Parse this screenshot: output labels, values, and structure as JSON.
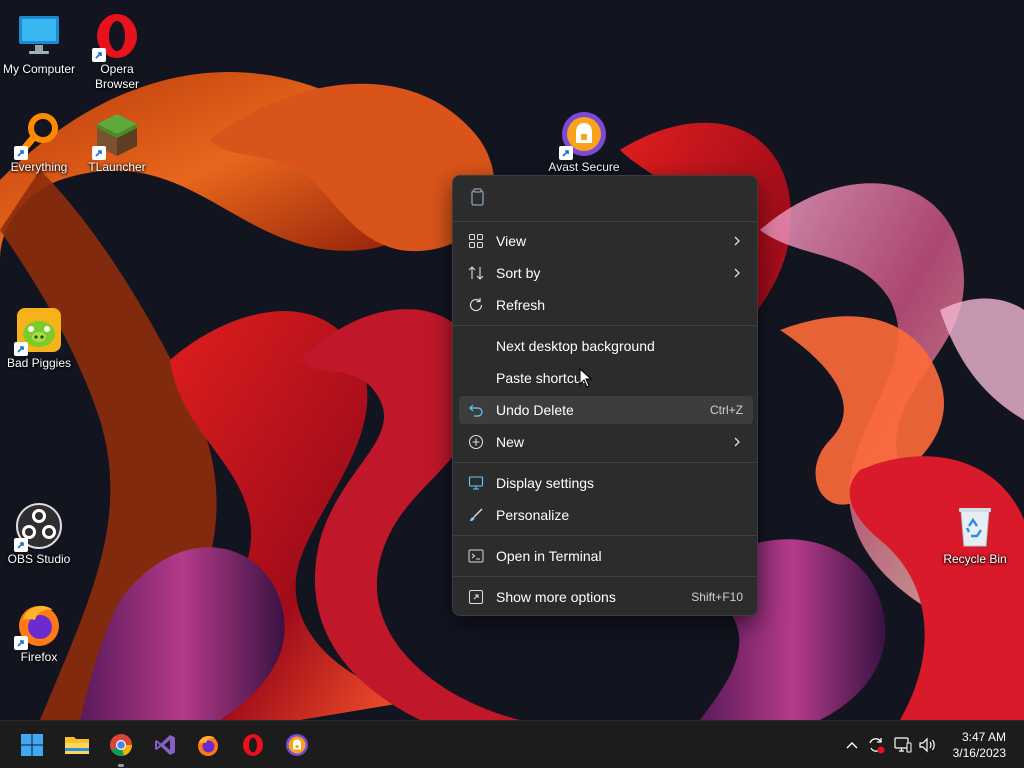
{
  "desktop": {
    "icons": [
      {
        "label": "My Computer"
      },
      {
        "label": "Opera\nBrowser"
      },
      {
        "label": "Everything"
      },
      {
        "label": "TLauncher"
      },
      {
        "label": "Avast Secure"
      },
      {
        "label": "Bad Piggies"
      },
      {
        "label": "OBS Studio"
      },
      {
        "label": "Firefox"
      },
      {
        "label": "Recycle Bin"
      }
    ]
  },
  "context_menu": {
    "top_actions": [
      {
        "icon": "paste-icon"
      }
    ],
    "items": [
      {
        "label": "View",
        "icon": "view-grid-icon",
        "submenu": true
      },
      {
        "label": "Sort by",
        "icon": "sort-icon",
        "submenu": true
      },
      {
        "label": "Refresh",
        "icon": "refresh-icon"
      },
      {
        "label": "Next desktop background"
      },
      {
        "label": "Paste shortcut"
      },
      {
        "label": "Undo Delete",
        "icon": "undo-icon",
        "shortcut": "Ctrl+Z",
        "highlighted": true
      },
      {
        "label": "New",
        "icon": "new-plus-icon",
        "submenu": true
      },
      {
        "label": "Display settings",
        "icon": "display-icon"
      },
      {
        "label": "Personalize",
        "icon": "brush-icon"
      },
      {
        "label": "Open in Terminal",
        "icon": "terminal-icon"
      },
      {
        "label": "Show more options",
        "icon": "more-options-icon",
        "shortcut": "Shift+F10"
      }
    ]
  },
  "taskbar": {
    "apps": [
      "start-icon",
      "file-explorer-icon",
      "chrome-icon",
      "visual-studio-icon",
      "firefox-icon",
      "opera-icon",
      "avast-browser-icon"
    ],
    "tray": [
      "chevron-up-icon",
      "sync-icon",
      "network-icon",
      "volume-icon"
    ],
    "clock": {
      "time": "3:47 AM",
      "date": "3/16/2023"
    }
  },
  "colors": {
    "menu_bg": "#2c2c2c",
    "highlight": "#3d3d3d",
    "taskbar": "#1c1c1c",
    "accent": "#60cdff"
  }
}
